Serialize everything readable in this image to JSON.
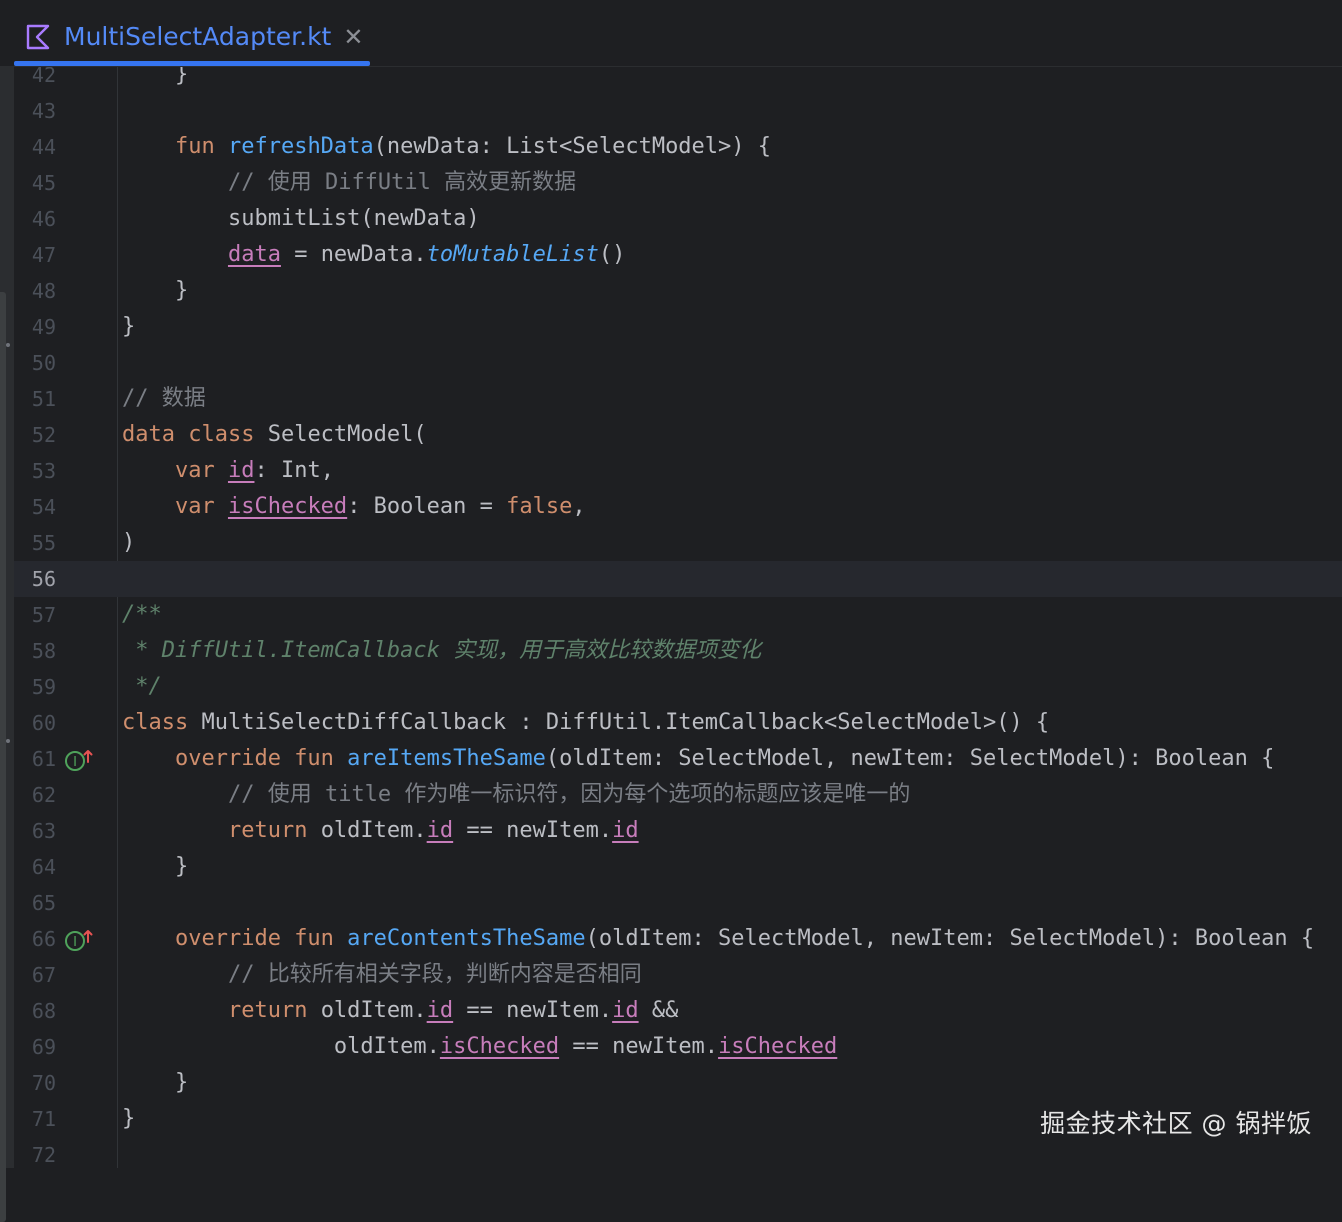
{
  "tab": {
    "title": "MultiSelectAdapter.kt",
    "close_glyph": "✕",
    "icon": "kotlin-file-icon",
    "accent": "#3574f0"
  },
  "current_line": 56,
  "lines": [
    {
      "n": "42",
      "tokens": [
        [
          "",
          "    }"
        ]
      ]
    },
    {
      "n": "43",
      "tokens": []
    },
    {
      "n": "44",
      "tokens": [
        [
          "",
          "    "
        ],
        [
          "kw",
          "fun "
        ],
        [
          "fn",
          "refreshData"
        ],
        [
          "",
          "(newData: List<SelectModel>) {"
        ]
      ]
    },
    {
      "n": "45",
      "tokens": [
        [
          "",
          "        "
        ],
        [
          "cm",
          "// 使用 DiffUtil 高效更新数据"
        ]
      ]
    },
    {
      "n": "46",
      "tokens": [
        [
          "",
          "        submitList(newData)"
        ]
      ]
    },
    {
      "n": "47",
      "tokens": [
        [
          "",
          "        "
        ],
        [
          "prop",
          "data"
        ],
        [
          "",
          " = newData."
        ],
        [
          "ext",
          "toMutableList"
        ],
        [
          "",
          "()"
        ]
      ]
    },
    {
      "n": "48",
      "tokens": [
        [
          "",
          "    }"
        ]
      ]
    },
    {
      "n": "49",
      "tokens": [
        [
          "",
          "}"
        ]
      ]
    },
    {
      "n": "50",
      "tokens": []
    },
    {
      "n": "51",
      "tokens": [
        [
          "cm",
          "// 数据"
        ]
      ]
    },
    {
      "n": "52",
      "tokens": [
        [
          "kw",
          "data class "
        ],
        [
          "",
          "SelectModel("
        ]
      ]
    },
    {
      "n": "53",
      "tokens": [
        [
          "",
          "    "
        ],
        [
          "kw",
          "var "
        ],
        [
          "prop",
          "id"
        ],
        [
          "",
          ": Int,"
        ]
      ]
    },
    {
      "n": "54",
      "tokens": [
        [
          "",
          "    "
        ],
        [
          "kw",
          "var "
        ],
        [
          "prop",
          "isChecked"
        ],
        [
          "",
          ": Boolean = "
        ],
        [
          "kw",
          "false"
        ],
        [
          "",
          ","
        ]
      ]
    },
    {
      "n": "55",
      "tokens": [
        [
          "",
          ")"
        ]
      ]
    },
    {
      "n": "56",
      "tokens": []
    },
    {
      "n": "57",
      "tokens": [
        [
          "doc",
          "/**"
        ]
      ]
    },
    {
      "n": "58",
      "tokens": [
        [
          "doc",
          " * DiffUtil.ItemCallback 实现，用于高效比较数据项变化"
        ]
      ]
    },
    {
      "n": "59",
      "tokens": [
        [
          "doc",
          " */"
        ]
      ]
    },
    {
      "n": "60",
      "tokens": [
        [
          "kw",
          "class "
        ],
        [
          "",
          "MultiSelectDiffCallback : DiffUtil.ItemCallback<SelectModel>() {"
        ]
      ]
    },
    {
      "n": "61",
      "icon": "implementation-up-icon",
      "tokens": [
        [
          "",
          "    "
        ],
        [
          "kw",
          "override fun "
        ],
        [
          "fn",
          "areItemsTheSame"
        ],
        [
          "",
          "(oldItem: SelectModel, newItem: SelectModel): Boolean {"
        ]
      ]
    },
    {
      "n": "62",
      "tokens": [
        [
          "",
          "        "
        ],
        [
          "cm",
          "// 使用 title 作为唯一标识符，因为每个选项的标题应该是唯一的"
        ]
      ]
    },
    {
      "n": "63",
      "tokens": [
        [
          "",
          "        "
        ],
        [
          "kw",
          "return "
        ],
        [
          "",
          "oldItem."
        ],
        [
          "prop",
          "id"
        ],
        [
          "",
          " == newItem."
        ],
        [
          "prop",
          "id"
        ]
      ]
    },
    {
      "n": "64",
      "tokens": [
        [
          "",
          "    }"
        ]
      ]
    },
    {
      "n": "65",
      "tokens": []
    },
    {
      "n": "66",
      "icon": "implementation-up-icon",
      "tokens": [
        [
          "",
          "    "
        ],
        [
          "kw",
          "override fun "
        ],
        [
          "fn",
          "areContentsTheSame"
        ],
        [
          "",
          "(oldItem: SelectModel, newItem: SelectModel): Boolean {"
        ]
      ]
    },
    {
      "n": "67",
      "tokens": [
        [
          "",
          "        "
        ],
        [
          "cm",
          "// 比较所有相关字段，判断内容是否相同"
        ]
      ]
    },
    {
      "n": "68",
      "tokens": [
        [
          "",
          "        "
        ],
        [
          "kw",
          "return "
        ],
        [
          "",
          "oldItem."
        ],
        [
          "prop",
          "id"
        ],
        [
          "",
          " == newItem."
        ],
        [
          "prop",
          "id"
        ],
        [
          "",
          " &&"
        ]
      ]
    },
    {
      "n": "69",
      "tokens": [
        [
          "",
          "                oldItem."
        ],
        [
          "prop",
          "isChecked"
        ],
        [
          "",
          " == newItem."
        ],
        [
          "prop",
          "isChecked"
        ]
      ]
    },
    {
      "n": "70",
      "tokens": [
        [
          "",
          "    }"
        ]
      ]
    },
    {
      "n": "71",
      "tokens": [
        [
          "",
          "}"
        ]
      ]
    },
    {
      "n": "72",
      "tokens": []
    }
  ],
  "watermark": "掘金技术社区 @ 锅拌饭"
}
